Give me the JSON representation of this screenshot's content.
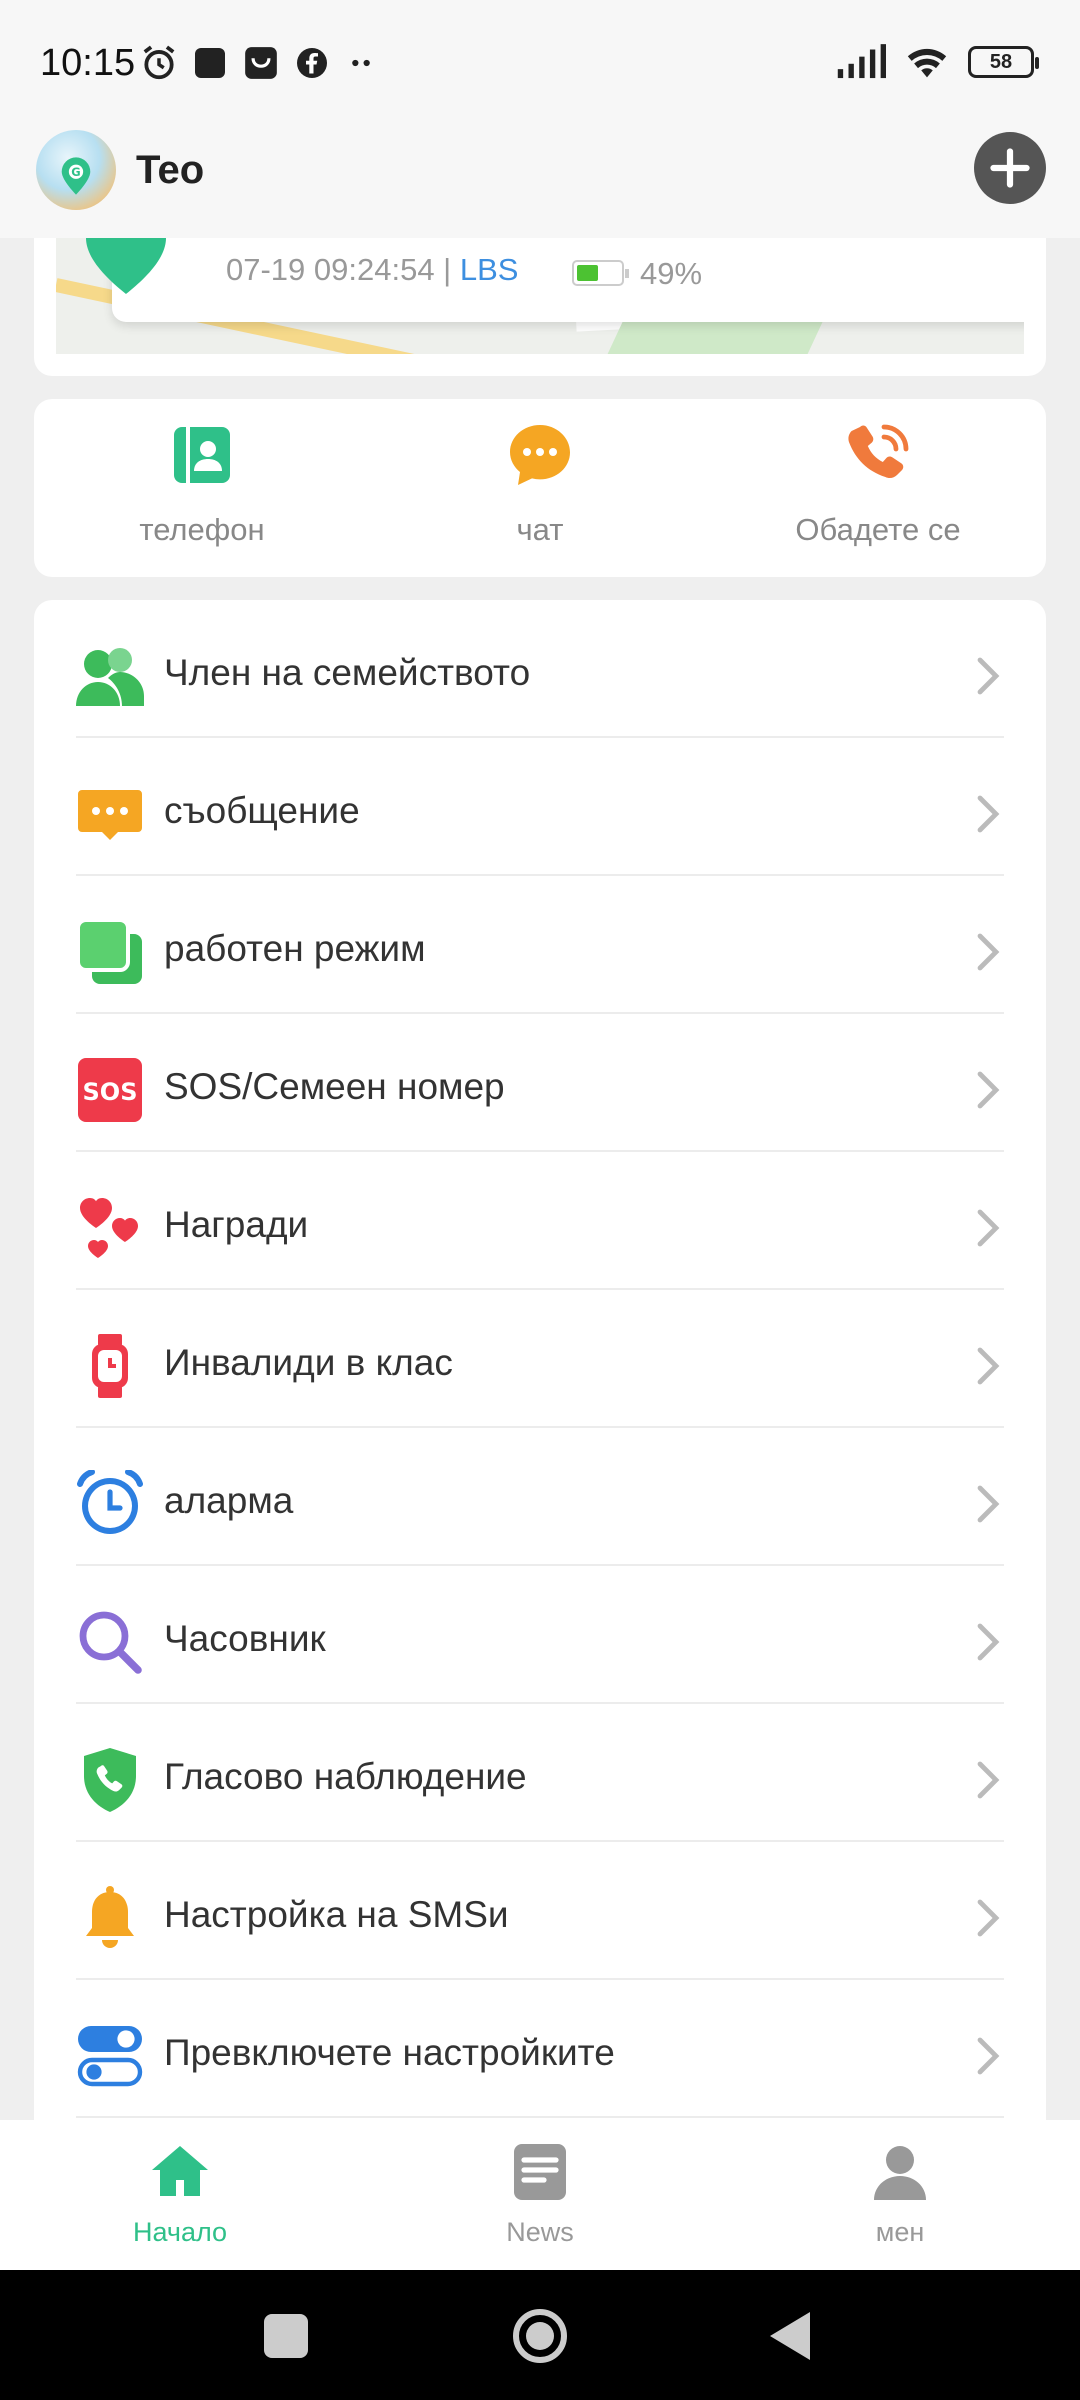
{
  "status_bar": {
    "time": "10:15",
    "battery": "58",
    "icons_left": [
      "alarm-icon",
      "app-icon",
      "shop-icon",
      "facebook-icon",
      "more-dots-icon"
    ],
    "icons_right": [
      "signal-icon",
      "wifi-icon",
      "battery-icon"
    ]
  },
  "header": {
    "title": "Teo",
    "add_icon": "plus-circle-icon"
  },
  "location": {
    "timestamp": "07-19 09:24:54 | ",
    "source": "LBS",
    "battery_percent": "49%",
    "battery_level": 0.49
  },
  "quick_actions": [
    {
      "label": "телефон",
      "icon": "contacts-icon",
      "color": "#2fc089"
    },
    {
      "label": "чат",
      "icon": "chat-bubble-icon",
      "color": "#f5a623"
    },
    {
      "label": "Обадете се",
      "icon": "phone-call-icon",
      "color": "#f07a3c"
    }
  ],
  "menu": [
    {
      "label": "Член на семейството",
      "icon": "family-member-icon"
    },
    {
      "label": "съобщение",
      "icon": "message-icon"
    },
    {
      "label": "работен режим",
      "icon": "work-mode-icon"
    },
    {
      "label": "SOS/Семеен номер",
      "icon": "sos-icon",
      "badge": "SOS"
    },
    {
      "label": "Награди",
      "icon": "hearts-icon"
    },
    {
      "label": "Инвалиди в клас",
      "icon": "watch-icon"
    },
    {
      "label": "аларма",
      "icon": "alarm-clock-icon"
    },
    {
      "label": "Часовник",
      "icon": "search-icon"
    },
    {
      "label": "Гласово наблюдение",
      "icon": "shield-phone-icon"
    },
    {
      "label": "Настройка на SMSи",
      "icon": "bell-icon"
    },
    {
      "label": "Превключете настройките",
      "icon": "toggle-icon"
    }
  ],
  "bottom_nav": [
    {
      "label": "Начало",
      "icon": "home-icon",
      "active": true
    },
    {
      "label": "News",
      "icon": "news-icon",
      "active": false
    },
    {
      "label": "мен",
      "icon": "person-icon",
      "active": false
    }
  ],
  "colors": {
    "accent": "#2fc089",
    "lbs": "#3d8fe0"
  }
}
